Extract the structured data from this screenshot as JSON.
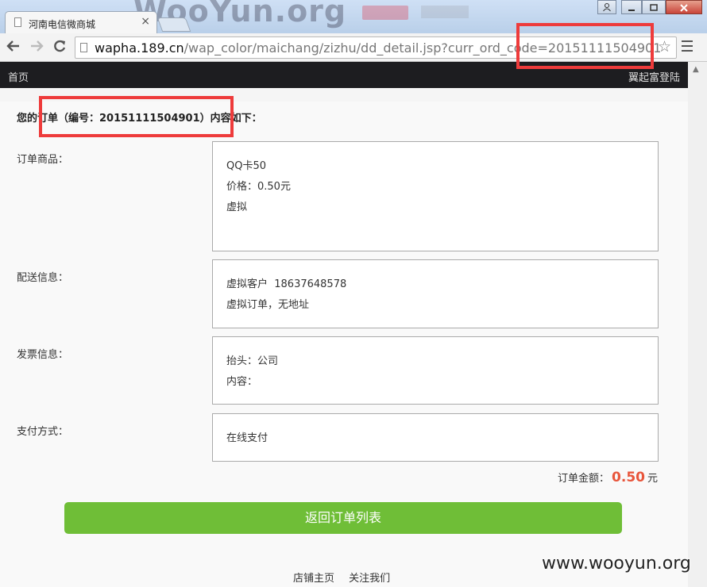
{
  "browser": {
    "tab_title": "河南电信微商城",
    "tab_close": "×",
    "url_host": "wapha.189.cn",
    "url_path": "/wap_color/maichang/zizhu/dd_detail.jsp?curr_ord_code=20151111504901",
    "watermark_top": "WooYun.org",
    "icons": [
      "document-icon",
      "back-arrow-icon",
      "forward-arrow-icon",
      "reload-icon",
      "star-icon",
      "menu-icon",
      "user-icon",
      "minimize-icon",
      "maximize-icon",
      "close-icon"
    ]
  },
  "nav": {
    "home": "首页",
    "login": "翼起富登陆"
  },
  "order": {
    "heading": "您的订单（编号：20151111504901）内容如下：",
    "product_label": "订单商品：",
    "product_lines": [
      "QQ卡50",
      "价格：0.50元",
      "虚拟"
    ],
    "shipping_label": "配送信息：",
    "shipping_lines": [
      "虚拟客户  18637648578",
      "虚拟订单，无地址"
    ],
    "invoice_label": "发票信息：",
    "invoice_lines": [
      "抬头：公司",
      "内容："
    ],
    "payment_label": "支付方式：",
    "payment_lines": [
      "在线支付"
    ],
    "total_label": "订单金额：",
    "total_amount": "0.50",
    "total_unit": "元"
  },
  "actions": {
    "back_button": "返回订单列表"
  },
  "footer": {
    "links": [
      "店铺主页",
      "关注我们"
    ]
  },
  "watermark_bottom": "www.wooyun.org",
  "colors": {
    "nav_bg": "#1d1d20",
    "button_green": "#6fbe37",
    "amount_red": "#e8553b",
    "highlight_red": "#ee3b3b"
  }
}
